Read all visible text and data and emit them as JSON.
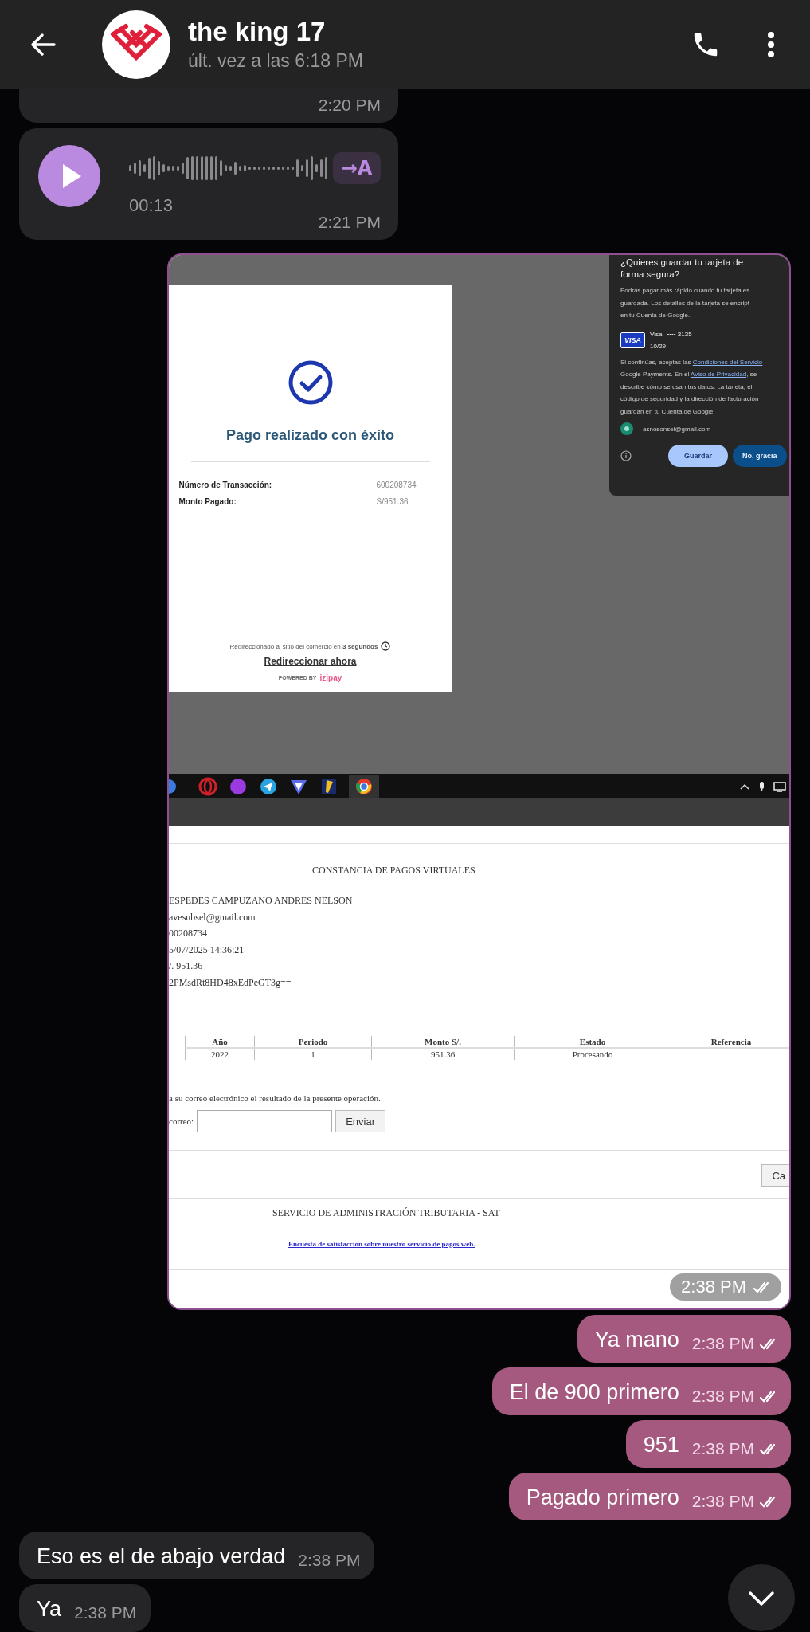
{
  "header": {
    "title": "the king 17",
    "status": "últ. vez a las 6:18 PM"
  },
  "messages": [
    {
      "kind": "voice",
      "outgoing": false,
      "partial": true,
      "time": "2:20 PM"
    },
    {
      "kind": "voice",
      "outgoing": false,
      "partial": false,
      "duration": "00:13",
      "transcribe": "→A",
      "time": "2:21 PM"
    },
    {
      "kind": "image",
      "outgoing": true,
      "time": "2:38 PM",
      "read": true,
      "screenshot": {
        "payment": {
          "title": "Pago realizado con éxito",
          "rows": [
            {
              "label": "Número de Transacción:",
              "value": "600208734"
            },
            {
              "label": "Monto Pagado:",
              "value": "S/951.36"
            }
          ],
          "redirect_note": "Redireccionado al sitio del comercio en **3 segundos**",
          "redirect_link": "Redireccionar ahora",
          "powered_by": "POWERED BY",
          "brand": "izipay"
        },
        "card_prompt": {
          "title": "¿Quieres guardar tu tarjeta de forma segura?",
          "body": [
            "Podrás pagar más rápido cuando tu tarjeta es",
            "guardada. Los detalles de la tarjeta se encript",
            "en tu Cuenta de Google."
          ],
          "card_brand": "VISA",
          "card_name": "Visa",
          "card_number": "•••• 3135",
          "card_expiry": "10/29",
          "terms": [
            [
              {
                "text": "Si continúas, aceptas las ",
                "link": false
              },
              {
                "text": "Condiciones del Servicio",
                "link": true
              }
            ],
            [
              {
                "text": "Google Payments. En el ",
                "link": false
              },
              {
                "text": "Aviso de Privacidad",
                "link": true
              },
              {
                "text": ", se",
                "link": false
              }
            ],
            [
              {
                "text": "describe cómo se usan tus datos. La tarjeta, el",
                "link": false
              }
            ],
            [
              {
                "text": "código de seguridad y la dirección de facturación",
                "link": false
              }
            ],
            [
              {
                "text": "guardan en tu Cuenta de Google.",
                "link": false
              }
            ]
          ],
          "account": "asnosonsel@gmail.com",
          "buttons": [
            {
              "label": "Guardar",
              "primary": false
            },
            {
              "label": "No, gracia",
              "primary": true
            }
          ]
        },
        "receipt": {
          "title": "CONSTANCIA DE PAGOS VIRTUALES",
          "details": [
            "ESPEDES CAMPUZANO ANDRES NELSON",
            "avesubsel@gmail.com",
            "00208734",
            "5/07/2025 14:36:21",
            "/. 951.36",
            "2PMsdRt8HD48xEdPeGT3g=="
          ],
          "columns": [
            "Año",
            "Periodo",
            "Monto S/.",
            "Estado",
            "Referencia"
          ],
          "row": [
            "2022",
            "1",
            "951.36",
            "Procesando"
          ],
          "email_note": "a su correo electrónico el resultado de la presente operación.",
          "email_label": "correo:",
          "send_button": "Enviar",
          "cut_button": "Ca",
          "footer": "SERVICIO DE ADMINISTRACIÓN TRIBUTARIA - SAT",
          "survey_link": "Encuesta de satisfacción sobre nuestro servicio de pagos web."
        }
      }
    },
    {
      "kind": "text",
      "outgoing": true,
      "text": "Ya mano",
      "time": "2:38 PM",
      "read": true
    },
    {
      "kind": "text",
      "outgoing": true,
      "text": "El de 900 primero",
      "time": "2:38 PM",
      "read": true
    },
    {
      "kind": "text",
      "outgoing": true,
      "text": "951",
      "time": "2:38 PM",
      "read": true
    },
    {
      "kind": "text",
      "outgoing": true,
      "text": "Pagado primero",
      "time": "2:38 PM",
      "read": true
    },
    {
      "kind": "text",
      "outgoing": false,
      "text": "Eso es el de abajo verdad",
      "time": "2:38 PM"
    },
    {
      "kind": "text",
      "outgoing": false,
      "text": "Ya",
      "time": "2:38 PM"
    }
  ]
}
